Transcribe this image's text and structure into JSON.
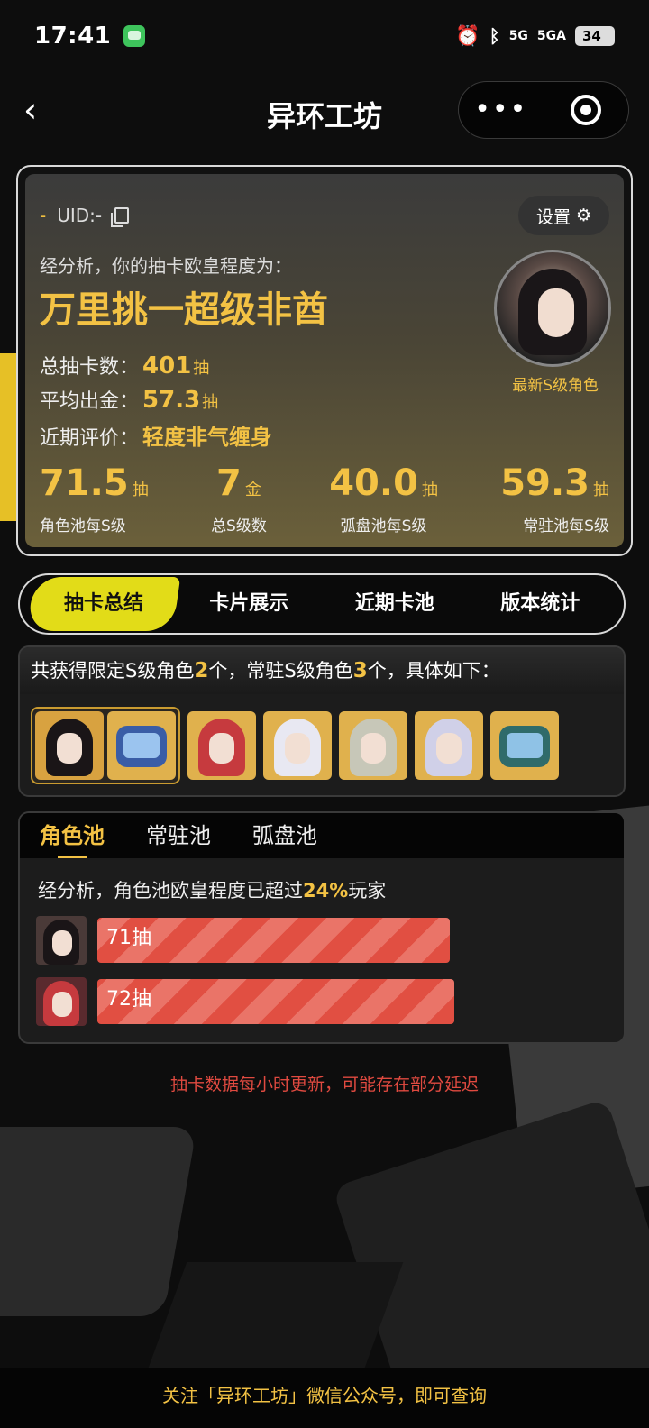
{
  "status_bar": {
    "time": "17:41",
    "signal1": "5G",
    "signal2": "5GA",
    "battery": "34"
  },
  "nav": {
    "title": "异环工坊"
  },
  "profile": {
    "uid_prefix": "-",
    "uid_label": "UID:-",
    "settings_label": "设置",
    "analysis_text": "经分析，你的抽卡欧皇程度为：",
    "verdict": "万里挑一超级非酋",
    "total_pulls_label": "总抽卡数：",
    "total_pulls_value": "401",
    "total_pulls_unit": "抽",
    "avg_gold_label": "平均出金：",
    "avg_gold_value": "57.3",
    "avg_gold_unit": "抽",
    "recent_eval_label": "近期评价：",
    "recent_eval_value": "轻度非气缠身",
    "avatar_caption": "最新S级角色",
    "stats": [
      {
        "value": "71.5",
        "unit": "抽",
        "label": "角色池每S级"
      },
      {
        "value": "7",
        "unit": "金",
        "label": "总S级数"
      },
      {
        "value": "40.0",
        "unit": "抽",
        "label": "弧盘池每S级"
      },
      {
        "value": "59.3",
        "unit": "抽",
        "label": "常驻池每S级"
      }
    ]
  },
  "tabs": [
    {
      "label": "抽卡总结",
      "active": true
    },
    {
      "label": "卡片展示",
      "active": false
    },
    {
      "label": "近期卡池",
      "active": false
    },
    {
      "label": "版本统计",
      "active": false
    }
  ],
  "summary": {
    "text_a": "共获得限定S级角色",
    "limited_count": "2",
    "text_b": "个，常驻S级角色",
    "standard_count": "3",
    "text_c": "个，具体如下："
  },
  "pool": {
    "tabs": [
      {
        "label": "角色池",
        "active": true
      },
      {
        "label": "常驻池",
        "active": false
      },
      {
        "label": "弧盘池",
        "active": false
      }
    ],
    "note_a": "经分析，角色池欧皇程度已超过",
    "note_percent": "24%",
    "note_b": "玩家",
    "bars": [
      {
        "label": "71抽",
        "pulls": 71
      },
      {
        "label": "72抽",
        "pulls": 72
      }
    ]
  },
  "update_note": "抽卡数据每小时更新，可能存在部分延迟",
  "footer": "关注「异环工坊」微信公众号，即可查询",
  "colors": {
    "accent_gold": "#f3c244",
    "tab_yellow": "#e2dc18",
    "bar_red": "#e14f42",
    "warning_red": "#e04a40"
  }
}
